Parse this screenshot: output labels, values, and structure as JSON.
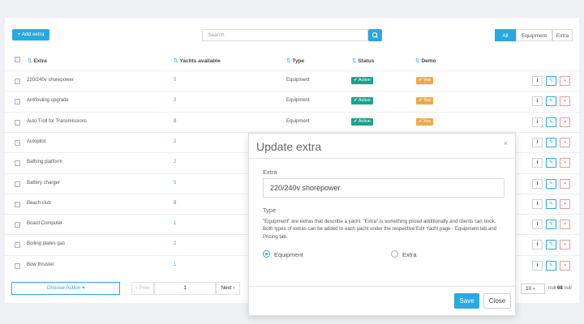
{
  "toolbar": {
    "add_label": "+ Add extra",
    "search_placeholder": "Search",
    "filters": [
      "All",
      "Equipment",
      "Extra"
    ]
  },
  "table": {
    "headers": [
      "Extra",
      "Yachts available",
      "Type",
      "Status",
      "Demo"
    ],
    "rows": [
      {
        "name": "220/240v shorepower",
        "yachts": "5",
        "type": "Equipment",
        "status": "Active",
        "demo": "Yes"
      },
      {
        "name": "Antifouling upgrade",
        "yachts": "3",
        "type": "Equipment",
        "status": "Active",
        "demo": "Yes"
      },
      {
        "name": "Auto Troll for Transmissions",
        "yachts": "0",
        "type": "Equipment",
        "status": "Active",
        "demo": "Yes"
      },
      {
        "name": "Autopilot",
        "yachts": "2"
      },
      {
        "name": "Bathing platform",
        "yachts": "2"
      },
      {
        "name": "Battery charger",
        "yachts": "5"
      },
      {
        "name": "Beach club",
        "yachts": "0"
      },
      {
        "name": "Board Computer",
        "yachts": "1"
      },
      {
        "name": "Boiling plates gas",
        "yachts": "2"
      },
      {
        "name": "Bow thruster",
        "yachts": "1"
      }
    ]
  },
  "footer": {
    "choose_action": "Choose Action ▾",
    "prev": "‹ Prev",
    "page": "1",
    "next": "Next ›",
    "per_page": "10",
    "total_prefix": "null",
    "total": "68",
    "total_suffix": "null"
  },
  "modal": {
    "title": "Update extra",
    "close_glyph": "×",
    "extra_label": "Extra",
    "extra_value": "220/240v shorepower",
    "type_label": "Type",
    "type_desc": "\"Equipment\" are extras that describe a yacht. \"Extra\" is something priced additionally and clients can book. Both types of extras can be added to each yacht under the respective Edit Yacht page - Equipment tab and Pricing tab.",
    "options": [
      "Equipment",
      "Extra"
    ],
    "selected": "Equipment",
    "save_label": "Save",
    "close_label": "Close"
  },
  "colors": {
    "accent": "#2aa8e0",
    "active": "#1ba38b",
    "yes": "#f0a94a",
    "danger": "#e04b4b"
  },
  "icons": {
    "search": "search-icon",
    "sort": "sort-icon",
    "info": "info-icon",
    "edit": "edit-icon",
    "delete": "trash-icon"
  }
}
